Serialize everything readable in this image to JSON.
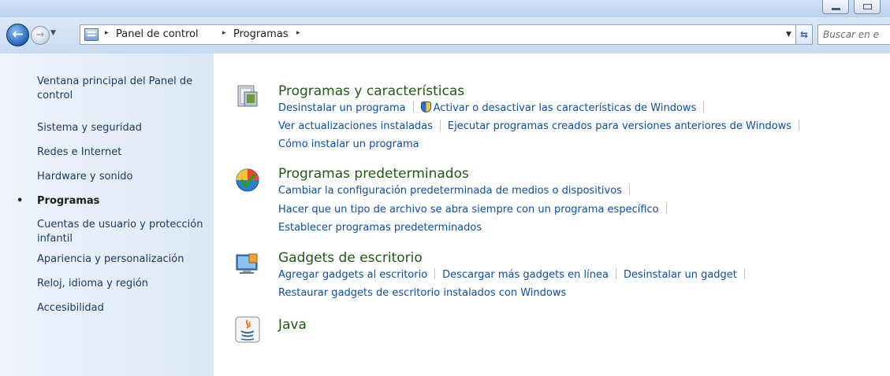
{
  "toolbar": {
    "back_icon": "back-arrow-icon",
    "forward_icon": "forward-arrow-icon",
    "recent_icon": "dropdown-arrow-icon",
    "refresh_icon": "refresh-icon"
  },
  "address": {
    "crumbs": [
      "Panel de control",
      "Programas"
    ],
    "separator": "▸",
    "dropdown_glyph": "▼"
  },
  "search": {
    "placeholder": "Buscar en e"
  },
  "sidebar": {
    "items": [
      {
        "label": "Ventana principal del Panel de control",
        "current": false
      },
      {
        "label": "Sistema y seguridad",
        "current": false
      },
      {
        "label": "Redes e Internet",
        "current": false
      },
      {
        "label": "Hardware y sonido",
        "current": false
      },
      {
        "label": "Programas",
        "current": true
      },
      {
        "label": "Cuentas de usuario y protección infantil",
        "current": false
      },
      {
        "label": "Apariencia y personalización",
        "current": false
      },
      {
        "label": "Reloj, idioma y región",
        "current": false
      },
      {
        "label": "Accesibilidad",
        "current": false
      }
    ],
    "bullet": "•"
  },
  "categories": [
    {
      "title": "Programas y características",
      "icon": "programs-features-icon",
      "links": [
        "Desinstalar un programa",
        "Activar o desactivar las características de Windows",
        "Ver actualizaciones instaladas",
        "Ejecutar programas creados para versiones anteriores de Windows",
        "Cómo instalar un programa"
      ]
    },
    {
      "title": "Programas predeterminados",
      "icon": "default-programs-icon",
      "links": [
        "Cambiar la configuración predeterminada de medios o dispositivos",
        "Hacer que un tipo de archivo se abra siempre con un programa específico",
        "Establecer programas predeterminados"
      ]
    },
    {
      "title": "Gadgets de escritorio",
      "icon": "desktop-gadgets-icon",
      "links": [
        "Agregar gadgets al escritorio",
        "Descargar más gadgets en línea",
        "Desinstalar un gadget",
        "Restaurar gadgets de escritorio instalados con Windows"
      ]
    },
    {
      "title": "Java",
      "icon": "java-icon",
      "links": []
    }
  ],
  "colors": {
    "link": "#0a4fa8",
    "category_title": "#1e5b12",
    "sidebar_text": "#1e3a65",
    "sidebar_bg": "#e6eef8"
  }
}
